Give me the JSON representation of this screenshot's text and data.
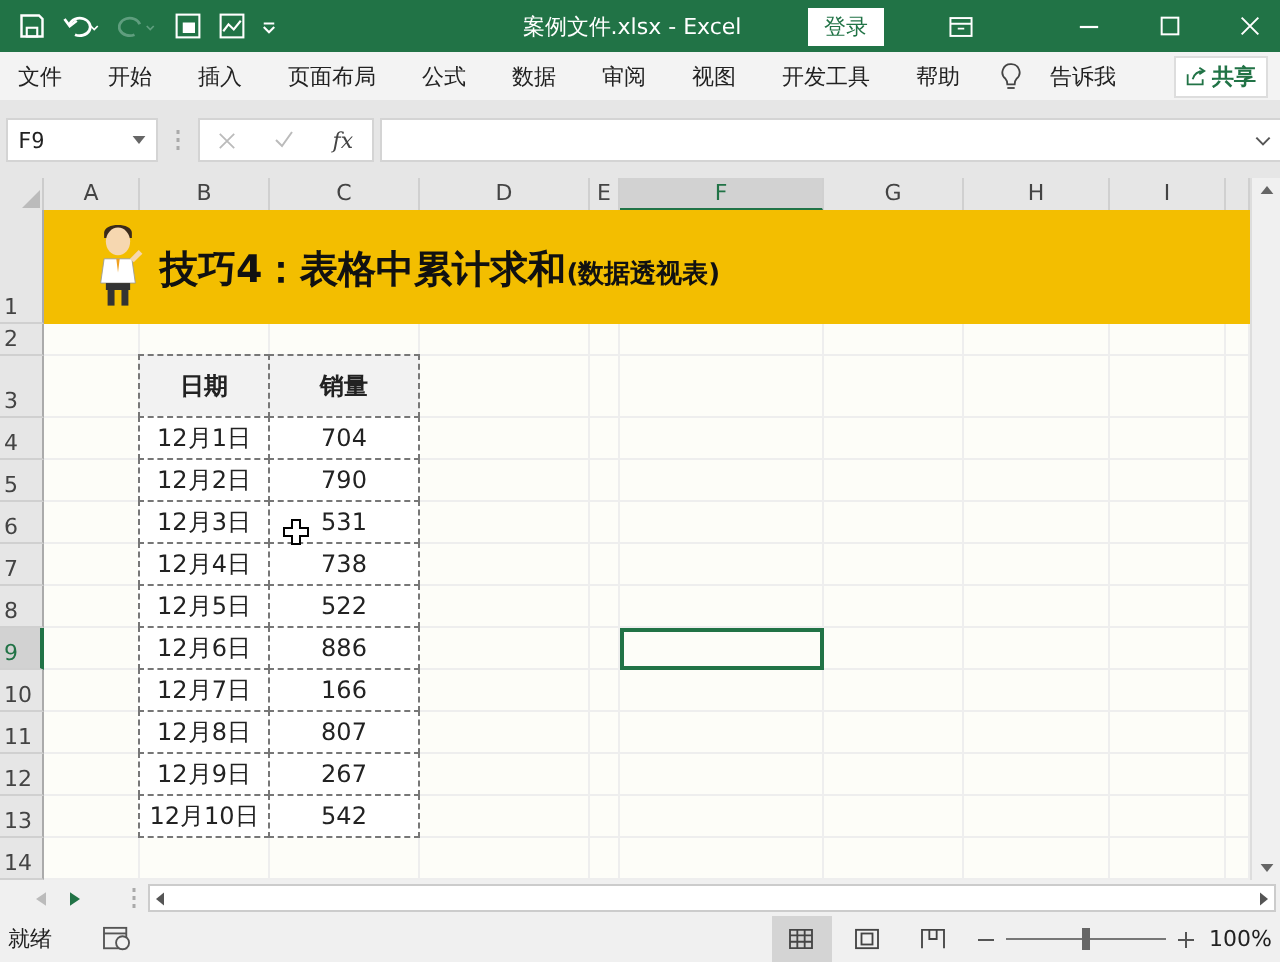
{
  "window": {
    "title": "案例文件.xlsx  -  Excel",
    "login_button": "登录"
  },
  "ribbon_tabs": [
    "文件",
    "开始",
    "插入",
    "页面布局",
    "公式",
    "数据",
    "审阅",
    "视图",
    "开发工具",
    "帮助"
  ],
  "tell_me": "告诉我",
  "share_button": "共享",
  "formula_bar": {
    "name_box": "F9",
    "function_label": "fx"
  },
  "columns": [
    {
      "label": "A",
      "selected": false
    },
    {
      "label": "B",
      "selected": false
    },
    {
      "label": "C",
      "selected": false
    },
    {
      "label": "D",
      "selected": false
    },
    {
      "label": "E",
      "selected": false
    },
    {
      "label": "F",
      "selected": true
    },
    {
      "label": "G",
      "selected": false
    },
    {
      "label": "H",
      "selected": false
    },
    {
      "label": "I",
      "selected": false
    }
  ],
  "rows": [
    {
      "label": "1",
      "selected": false
    },
    {
      "label": "2",
      "selected": false
    },
    {
      "label": "3",
      "selected": false
    },
    {
      "label": "4",
      "selected": false
    },
    {
      "label": "5",
      "selected": false
    },
    {
      "label": "6",
      "selected": false
    },
    {
      "label": "7",
      "selected": false
    },
    {
      "label": "8",
      "selected": false
    },
    {
      "label": "9",
      "selected": true
    },
    {
      "label": "10",
      "selected": false
    },
    {
      "label": "11",
      "selected": false
    },
    {
      "label": "12",
      "selected": false
    },
    {
      "label": "13",
      "selected": false
    },
    {
      "label": "14",
      "selected": false
    }
  ],
  "banner": {
    "title": "技巧4：表格中累计求和",
    "subtitle": "(数据透视表)"
  },
  "table": {
    "columns": [
      "日期",
      "销量"
    ],
    "rows": [
      [
        "12月1日",
        "704"
      ],
      [
        "12月2日",
        "790"
      ],
      [
        "12月3日",
        "531"
      ],
      [
        "12月4日",
        "738"
      ],
      [
        "12月5日",
        "522"
      ],
      [
        "12月6日",
        "886"
      ],
      [
        "12月7日",
        "166"
      ],
      [
        "12月8日",
        "807"
      ],
      [
        "12月9日",
        "267"
      ],
      [
        "12月10日",
        "542"
      ]
    ]
  },
  "status_bar": {
    "status": "就绪",
    "views": [
      {
        "kind": "normal",
        "selected": true
      },
      {
        "kind": "page_layout",
        "selected": false
      },
      {
        "kind": "page_break",
        "selected": false
      }
    ],
    "zoom": "100%",
    "zoom_slider": {
      "level": 0.5
    }
  }
}
